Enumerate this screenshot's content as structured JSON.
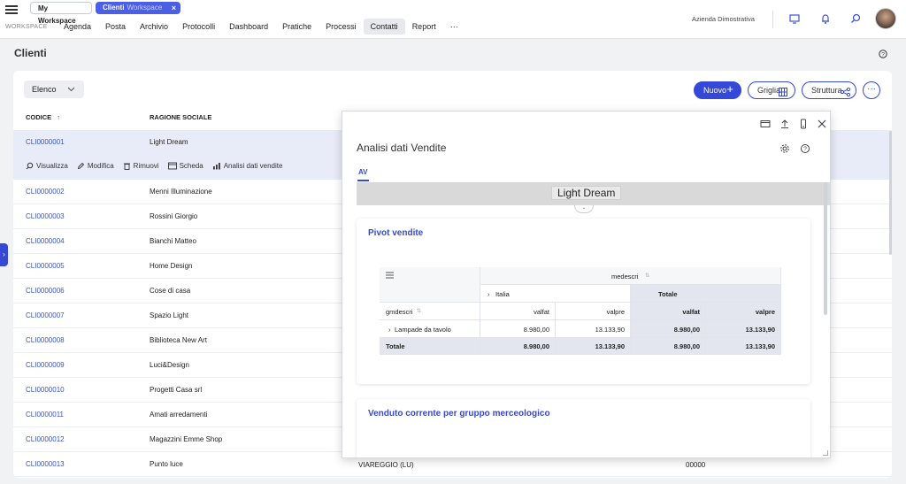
{
  "topbar": {
    "tab_workspace": "My Workspace",
    "tab_clienti": "Clienti",
    "tab_clienti_sub": "Workspace",
    "tab_close": "×",
    "workspace_label": "WORKSPACE",
    "menu": [
      "Agenda",
      "Posta",
      "Archivio",
      "Protocolli",
      "Dashboard",
      "Pratiche",
      "Processi",
      "Contatti",
      "Report",
      "···"
    ],
    "active_menu": "Contatti",
    "company": "Azienda Dimostrativa"
  },
  "page": {
    "title": "Clienti",
    "view_select": "Elenco",
    "btn_nuovo": "Nuovo",
    "btn_griglia": "Griglia",
    "btn_struttura": "Struttura",
    "btn_more": "···",
    "col_codice": "CODICE",
    "col_ragione": "RAGIONE SOCIALE"
  },
  "row_actions": [
    "Visualizza",
    "Modifica",
    "Rimuovi",
    "Scheda",
    "Analisi dati vendite"
  ],
  "clients": [
    {
      "code": "CLI0000001",
      "name": "Light Dream"
    },
    {
      "code": "CLI0000002",
      "name": "Menni Illuminazione"
    },
    {
      "code": "CLI0000003",
      "name": "Rossini Giorgio"
    },
    {
      "code": "CLI0000004",
      "name": "Bianchi Matteo"
    },
    {
      "code": "CLI0000005",
      "name": "Home Design"
    },
    {
      "code": "CLI0000006",
      "name": "Cose di casa"
    },
    {
      "code": "CLI0000007",
      "name": "Spazio Light"
    },
    {
      "code": "CLI0000008",
      "name": "Biblioteca New Art"
    },
    {
      "code": "CLI0000009",
      "name": "Luci&Design"
    },
    {
      "code": "CLI0000010",
      "name": "Progetti Casa srl"
    },
    {
      "code": "CLI0000011",
      "name": "Amati arredamenti"
    },
    {
      "code": "CLI0000012",
      "name": "Magazzini Emme Shop"
    },
    {
      "code": "CLI0000013",
      "name": "Punto luce"
    }
  ],
  "last_row_extra": {
    "city": "VIAREGGIO (LU)",
    "cap": "00000"
  },
  "dialog": {
    "title": "Analisi dati Vendite",
    "tab": "AV",
    "header_label": "Light Dream",
    "panel1_title": "Pivot vendite",
    "panel2_title": "Venduto corrente per gruppo merceologico",
    "pivot": {
      "col_field": "medescri",
      "col_group": "Italia",
      "total_label": "Totale",
      "row_field": "gmdescri",
      "measure1": "valfat",
      "measure2": "valpre",
      "row1_label": "Lampade da tavolo",
      "row1_valfat": "8.980,00",
      "row1_valpre": "13.133,90",
      "row1_tot_valfat": "8.980,00",
      "row1_tot_valpre": "13.133,90",
      "total_row_label": "Totale",
      "tot_valfat": "8.980,00",
      "tot_valpre": "13.133,90",
      "grand_valfat": "8.980,00",
      "grand_valpre": "13.133,90"
    }
  },
  "colors": {
    "accent": "#3549d6",
    "link": "#3a55c8",
    "selected_row": "#e8ebf8"
  }
}
